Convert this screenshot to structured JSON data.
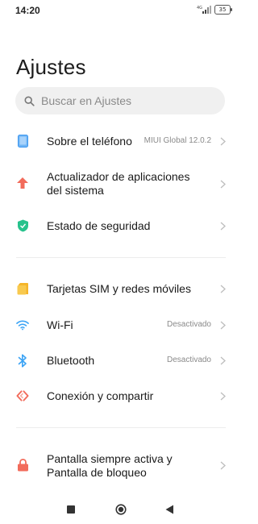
{
  "status_bar": {
    "time": "14:20",
    "network": "4G",
    "battery": "35"
  },
  "page": {
    "title": "Ajustes"
  },
  "search": {
    "placeholder": "Buscar en Ajustes"
  },
  "items": [
    {
      "label": "Sobre el teléfono",
      "value": "MIUI Global 12.0.2",
      "icon": "phone-icon",
      "color": "#3d97f0"
    },
    {
      "label_line1": "Actualizador de aplicaciones",
      "label_line2": "del sistema",
      "value": "",
      "icon": "arrow-up-icon",
      "color": "#f26b5b"
    },
    {
      "label": "Estado de seguridad",
      "value": "",
      "icon": "shield-check-icon",
      "color": "#27c28c"
    },
    {
      "label": "Tarjetas SIM y redes móviles",
      "value": "",
      "icon": "sim-card-icon",
      "color": "#f5b52a"
    },
    {
      "label": "Wi-Fi",
      "value": "Desactivado",
      "icon": "wifi-icon",
      "color": "#3aa3f5"
    },
    {
      "label": "Bluetooth",
      "value": "Desactivado",
      "icon": "bluetooth-icon",
      "color": "#3aa3f5"
    },
    {
      "label": "Conexión y compartir",
      "value": "",
      "icon": "share-connection-icon",
      "color": "#f26b5b"
    },
    {
      "label_line1": "Pantalla siempre activa y",
      "label_line2": "Pantalla de bloqueo",
      "value": "",
      "icon": "lock-icon",
      "color": "#f26b5b"
    }
  ],
  "nav": {
    "buttons": [
      "recent-apps",
      "home",
      "back"
    ]
  }
}
